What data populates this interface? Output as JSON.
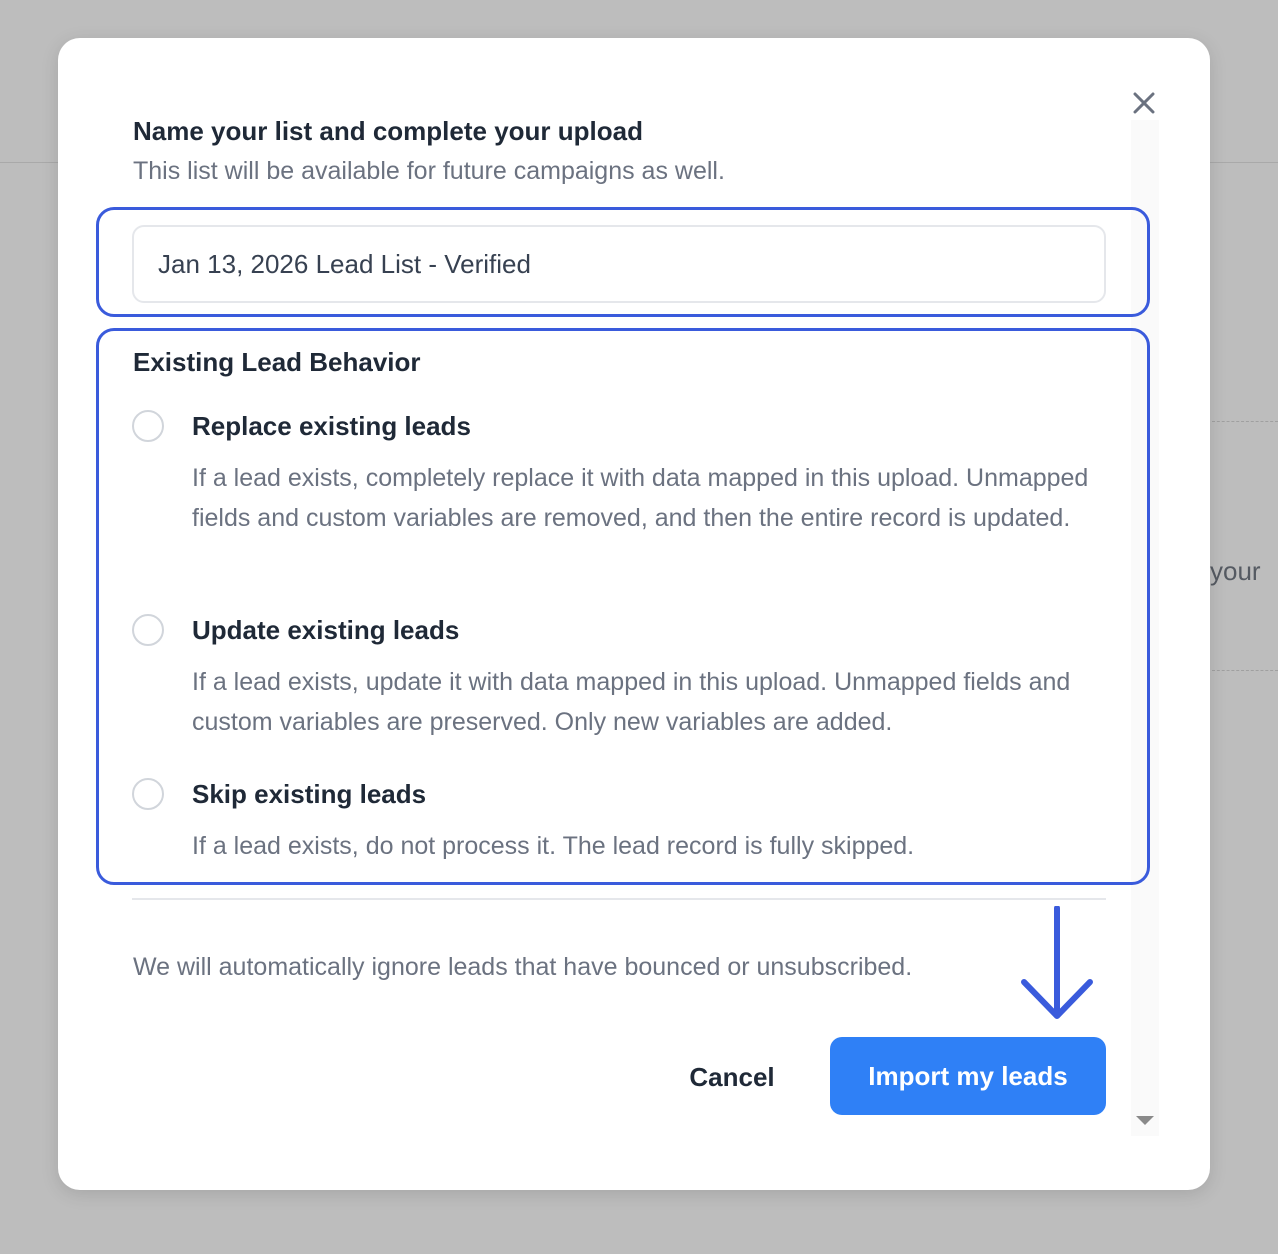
{
  "background": {
    "partial_text": "your"
  },
  "modal": {
    "title": "Name your list and complete your upload",
    "subtitle": "This list will be available for future campaigns as well.",
    "list_name": {
      "value": "Jan 13, 2026 Lead List - Verified"
    },
    "close_icon": "close-icon",
    "existing_lead_behavior": {
      "label": "Existing Lead Behavior",
      "options": [
        {
          "label": "Replace existing leads",
          "description": "If a lead exists, completely replace it with data mapped in this upload. Unmapped fields and custom variables are removed, and then the entire record is updated.",
          "selected": false
        },
        {
          "label": "Update existing leads",
          "description": "If a lead exists, update it with data mapped in this upload. Unmapped fields and custom variables are preserved. Only new variables are added.",
          "selected": false
        },
        {
          "label": "Skip existing leads",
          "description": "If a lead exists, do not process it. The lead record is fully skipped.",
          "selected": false
        }
      ]
    },
    "note": "We will automatically ignore leads that have bounced or unsubscribed.",
    "buttons": {
      "cancel": "Cancel",
      "import": "Import my leads"
    }
  },
  "colors": {
    "accent": "#2f80f6",
    "highlight": "#3a5bdc",
    "overlay": "#bdbdbd"
  }
}
